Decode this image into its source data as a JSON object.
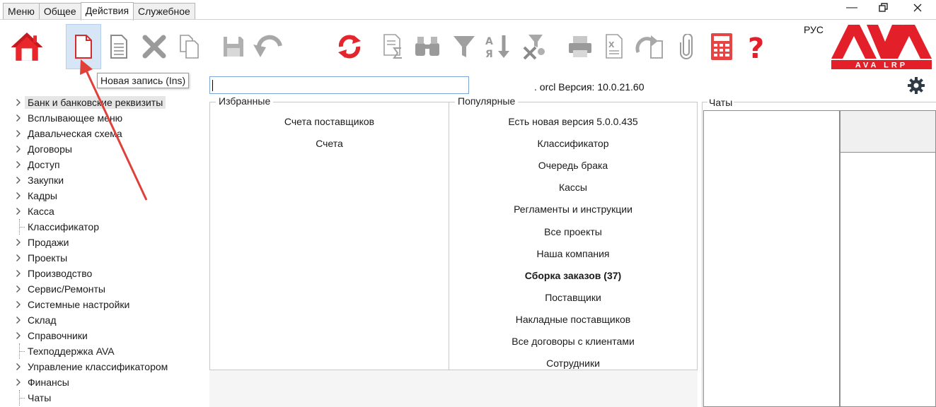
{
  "tabs": [
    "Меню",
    "Общее",
    "Действия",
    "Служебное"
  ],
  "active_tab": "Действия",
  "toolbar": {
    "tooltip": "Новая запись (Ins)"
  },
  "language": "РУС",
  "logo": {
    "text": "AVA",
    "subtitle": "AVA LRP",
    "color": "#e3202a"
  },
  "version_text": ". orcl Версия: 10.0.21.60",
  "search": {
    "value": ""
  },
  "tree": [
    {
      "label": "Банк и банковские реквизиты",
      "expandable": true,
      "selected": true
    },
    {
      "label": "Всплывающее меню",
      "expandable": true
    },
    {
      "label": "Давальческая схема",
      "expandable": true
    },
    {
      "label": "Договоры",
      "expandable": true
    },
    {
      "label": "Доступ",
      "expandable": true
    },
    {
      "label": "Закупки",
      "expandable": true
    },
    {
      "label": "Кадры",
      "expandable": true
    },
    {
      "label": "Касса",
      "expandable": true
    },
    {
      "label": "Классификатор",
      "expandable": false
    },
    {
      "label": "Продажи",
      "expandable": true
    },
    {
      "label": "Проекты",
      "expandable": true
    },
    {
      "label": "Производство",
      "expandable": true
    },
    {
      "label": "Сервис/Ремонты",
      "expandable": true
    },
    {
      "label": "Системные настройки",
      "expandable": true
    },
    {
      "label": "Склад",
      "expandable": true
    },
    {
      "label": "Справочники",
      "expandable": true
    },
    {
      "label": "Техподдержка AVA",
      "expandable": false
    },
    {
      "label": "Управление классификатором",
      "expandable": true
    },
    {
      "label": "Финансы",
      "expandable": true
    },
    {
      "label": "Чаты",
      "expandable": false
    }
  ],
  "favorites": {
    "title": "Избранные",
    "items": [
      "Счета поставщиков",
      "Счета"
    ]
  },
  "popular": {
    "title": "Популярные",
    "items": [
      {
        "label": "Есть новая версия 5.0.0.435",
        "bold": false
      },
      {
        "label": "Классификатор",
        "bold": false
      },
      {
        "label": "Очередь брака",
        "bold": false
      },
      {
        "label": "Кассы",
        "bold": false
      },
      {
        "label": "Регламенты и инструкции",
        "bold": false
      },
      {
        "label": "Все проекты",
        "bold": false
      },
      {
        "label": "Наша компания",
        "bold": false
      },
      {
        "label": "Сборка заказов (37)",
        "bold": true
      },
      {
        "label": "Поставщики",
        "bold": false
      },
      {
        "label": "Накладные поставщиков",
        "bold": false
      },
      {
        "label": "Все договоры с клиентами",
        "bold": false
      },
      {
        "label": "Сотрудники",
        "bold": false
      }
    ]
  },
  "chats": {
    "title": "Чаты"
  },
  "colors": {
    "accent_red": "#e3202a",
    "selection": "#d6e6f6"
  }
}
